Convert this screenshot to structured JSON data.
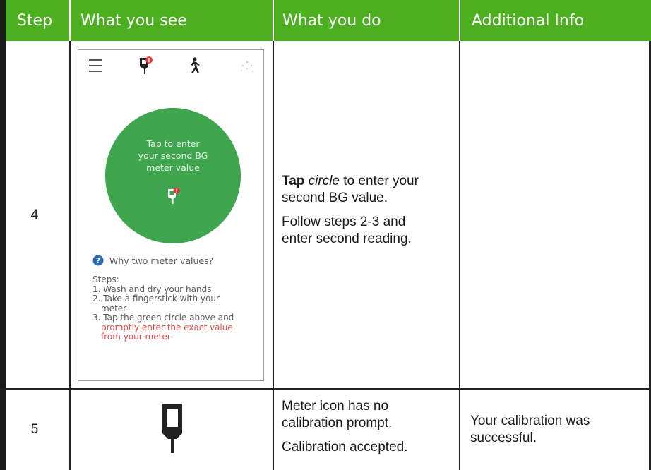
{
  "header": {
    "col_step": "Step",
    "col_see": "What you see",
    "col_do": "What you do",
    "col_info": "Additional Info"
  },
  "rows": [
    {
      "step": "4",
      "phone": {
        "circle_lines": [
          "Tap to enter",
          "your second BG",
          "meter value"
        ],
        "why_link": "Why two meter values?",
        "steps_label": "Steps:",
        "step_lines": [
          "1. Wash and dry your hands",
          "2. Take a fingerstick with your",
          "meter",
          "3. Tap the green circle above and"
        ],
        "warning_lines": [
          "promptly enter the exact value",
          "from your meter"
        ]
      },
      "do_bold": "Tap",
      "do_italic": "circle",
      "do_rest_1": " to enter your",
      "do_rest_2": "second BG value.",
      "do_p2_line1": "Follow steps 2-3 and",
      "do_p2_line2": "enter second reading.",
      "info": ""
    },
    {
      "step": "5",
      "do_line1": "Meter icon has no",
      "do_line2": "calibration prompt.",
      "do_line3": "Calibration accepted.",
      "info_line1": "Your calibration was",
      "info_line2": "successful."
    }
  ],
  "colors": {
    "header_bg": "#4caf1f",
    "circle": "#3fa54f",
    "warning": "#e14b4b",
    "help_icon": "#2a6fb8"
  },
  "icons": [
    "menu-icon",
    "meter-alert-icon",
    "activity-icon",
    "loading-dots-icon",
    "meter-icon",
    "help-icon"
  ]
}
